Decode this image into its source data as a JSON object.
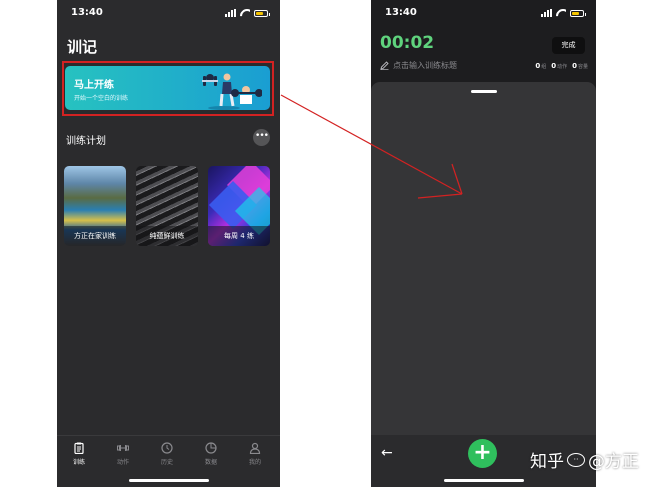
{
  "left_phone": {
    "status_time": "13:40",
    "page_title": "训记",
    "start_card": {
      "title": "马上开练",
      "subtitle": "开始一个空白的训练"
    },
    "section_title": "训练计划",
    "more_label": "•••",
    "plans": [
      {
        "label": "方正在家训练"
      },
      {
        "label": "纯蕴鲜训练"
      },
      {
        "label": "每周 4 练"
      }
    ],
    "tabs": [
      {
        "label": "训练",
        "icon": "clipboard-icon",
        "active": true
      },
      {
        "label": "动作",
        "icon": "dumbbell-icon",
        "active": false
      },
      {
        "label": "历史",
        "icon": "clock-icon",
        "active": false
      },
      {
        "label": "数据",
        "icon": "pie-chart-icon",
        "active": false
      },
      {
        "label": "我的",
        "icon": "person-icon",
        "active": false
      }
    ]
  },
  "right_phone": {
    "status_time": "13:40",
    "timer": "00:02",
    "done_label": "完成",
    "title_placeholder": "点击输入训练标题",
    "stats": [
      {
        "value": "0",
        "unit": "组"
      },
      {
        "value": "0",
        "unit": "动作"
      },
      {
        "value": "0",
        "unit": "容量"
      }
    ],
    "back_icon": "←",
    "add_icon": "+"
  },
  "watermark": {
    "site": "知乎",
    "author": "@方正"
  },
  "colors": {
    "highlight": "#d32222",
    "accent_green": "#2fbf5d",
    "timer_green": "#5fd37d",
    "card_gradient_start": "#27c2c0",
    "card_gradient_end": "#1a9ed2"
  }
}
